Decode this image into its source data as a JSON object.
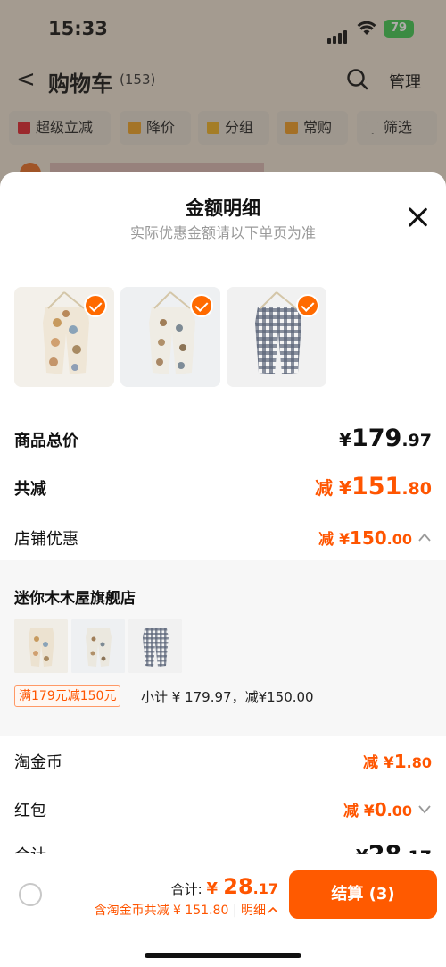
{
  "status_bar": {
    "time": "15:33",
    "battery": "79"
  },
  "nav": {
    "back_glyph": "<",
    "title": "购物车",
    "count": "(153)",
    "manage": "管理"
  },
  "chips": [
    "超级立减",
    "降价",
    "分组",
    "常购",
    "筛选"
  ],
  "modal": {
    "title": "金额明细",
    "subtitle": "实际优惠金额请以下单页为准",
    "rows": {
      "goods_total": {
        "label": "商品总价",
        "currency": "¥",
        "int": "179",
        "dec": ".97"
      },
      "total_reduce": {
        "label": "共减",
        "prefix": "减 ¥",
        "int": "151",
        "dec": ".80"
      },
      "shop_discount": {
        "label": "店铺优惠",
        "prefix": "减 ¥",
        "int": "150",
        "dec": ".00"
      },
      "coins": {
        "label": "淘金币",
        "prefix": "减 ¥",
        "int": "1",
        "dec": ".80"
      },
      "red_packet": {
        "label": "红包",
        "prefix": "减 ¥",
        "int": "0",
        "dec": ".00"
      },
      "sum": {
        "label": "合计",
        "currency": "¥",
        "int": "28",
        "dec": ".17"
      }
    },
    "store": {
      "name": "迷你木木屋旗舰店",
      "promo_tag": "满179元减150元",
      "subtotal": "小计 ¥ 179.97，减¥150.00"
    }
  },
  "bottom": {
    "total_label": "合计: ",
    "total_currency": "¥ ",
    "total_int": "28",
    "total_dec": ".17",
    "savings": "含淘金币共减 ¥ 151.80",
    "detail": "明细",
    "checkout": "结算 (3)"
  },
  "colors": {
    "accent": "#ff5500",
    "checkout": "#ff5a00",
    "check": "#ff6a00"
  },
  "icons": [
    "back-icon",
    "search-icon",
    "filter-icon",
    "close-icon",
    "check-icon",
    "chevron-up-icon",
    "chevron-down-icon",
    "radio-icon"
  ]
}
